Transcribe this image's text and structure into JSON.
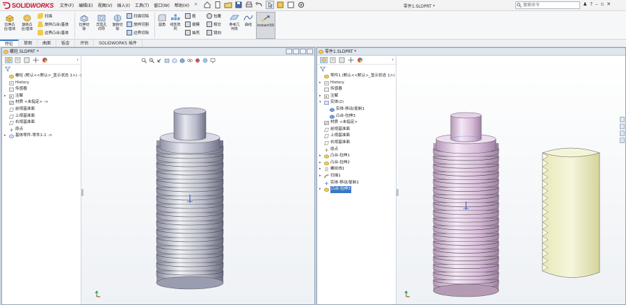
{
  "app": {
    "brand_prefix": "3S",
    "brand_solid": "SOLID",
    "brand_works": "WORKS",
    "doc_title": "零件1.SLDPRT *",
    "search_placeholder": "搜索命令"
  },
  "menu": [
    "文件(F)",
    "编辑(E)",
    "视图(V)",
    "插入(I)",
    "工具(T)",
    "窗口(W)",
    "帮助(H)"
  ],
  "ribbon": {
    "big": [
      {
        "label": "拉伸凸\n台/基体"
      },
      {
        "label": "旋转凸\n台/基体"
      },
      {
        "label": "拉伸切\n除"
      },
      {
        "label": "异型孔\n向导"
      },
      {
        "label": "旋转切\n除"
      },
      {
        "label": "参考几\n何体"
      },
      {
        "label": "曲线"
      },
      {
        "label": "Instant3D"
      }
    ],
    "small": [
      {
        "label": "扫描"
      },
      {
        "label": "放样凸台/基体"
      },
      {
        "label": "边界凸台/基体"
      },
      {
        "label": "扫描切除"
      },
      {
        "label": "放样切割"
      },
      {
        "label": "边界切除"
      },
      {
        "label": "圆角"
      },
      {
        "label": "线性阵\n列"
      },
      {
        "label": "筋"
      },
      {
        "label": "拔模"
      },
      {
        "label": "抽壳"
      },
      {
        "label": "包覆"
      },
      {
        "label": "相交"
      },
      {
        "label": "镜向"
      }
    ]
  },
  "tabs": [
    "特征",
    "草图",
    "曲面",
    "钣金",
    "评估",
    "SOLIDWORKS 插件"
  ],
  "left_window": {
    "title": "螺柱.SLDPRT *",
    "tree": [
      {
        "label": "螺柱 (默认<<默认>_显示状态 1>) ->",
        "icon": "part-icon",
        "arrow": ""
      },
      {
        "label": "History",
        "icon": "history-icon",
        "arrow": ""
      },
      {
        "label": "传感器",
        "icon": "sensor-icon",
        "arrow": ""
      },
      {
        "label": "注解",
        "icon": "annotation-icon",
        "arrow": "▸"
      },
      {
        "label": "材质 <未指定> ->",
        "icon": "material-icon",
        "arrow": ""
      },
      {
        "label": "前视基准面",
        "icon": "plane-icon",
        "arrow": ""
      },
      {
        "label": "上视基准面",
        "icon": "plane-icon",
        "arrow": ""
      },
      {
        "label": "右视基准面",
        "icon": "plane-icon",
        "arrow": ""
      },
      {
        "label": "原点",
        "icon": "origin-icon",
        "arrow": ""
      },
      {
        "label": "基体零件-零件1-1 ->",
        "icon": "base-part-icon",
        "arrow": "▸"
      }
    ]
  },
  "right_window": {
    "title": "零件1.SLDPRT *",
    "tree": [
      {
        "label": "零件1 (默认<<默认>_显示状态 1>)",
        "icon": "part-icon",
        "arrow": ""
      },
      {
        "label": "History",
        "icon": "history-icon",
        "arrow": "▸"
      },
      {
        "label": "传感器",
        "icon": "sensor-icon",
        "arrow": ""
      },
      {
        "label": "注解",
        "icon": "annotation-icon",
        "arrow": "▸"
      },
      {
        "label": "实体(2)",
        "icon": "solid-bodies-icon",
        "arrow": "▾"
      },
      {
        "label": "实体-移动/复制1",
        "icon": "body-icon",
        "arrow": "",
        "indent": 1
      },
      {
        "label": "凸台-拉伸3",
        "icon": "body-icon",
        "arrow": "",
        "indent": 1
      },
      {
        "label": "材质 <未指定>",
        "icon": "material-icon",
        "arrow": ""
      },
      {
        "label": "前视基准面",
        "icon": "plane-icon",
        "arrow": ""
      },
      {
        "label": "上视基准面",
        "icon": "plane-icon",
        "arrow": ""
      },
      {
        "label": "右视基准面",
        "icon": "plane-icon",
        "arrow": ""
      },
      {
        "label": "原点",
        "icon": "origin-icon",
        "arrow": ""
      },
      {
        "label": "凸台-拉伸1",
        "icon": "extrude-icon",
        "arrow": "▸"
      },
      {
        "label": "凸台-拉伸2",
        "icon": "extrude-icon",
        "arrow": "▸"
      },
      {
        "label": "螺纹线1",
        "icon": "helix-icon",
        "arrow": "▸"
      },
      {
        "label": "扫描1",
        "icon": "sweep-icon",
        "arrow": "▸"
      },
      {
        "label": "实体-移动/复制1",
        "icon": "move-icon",
        "arrow": ""
      },
      {
        "label": "凸台-拉伸3",
        "icon": "extrude-icon",
        "arrow": "▸",
        "highlight": true
      }
    ]
  },
  "colors": {
    "accent": "#3b78c4",
    "stud_body": "#c7c8d6",
    "pink_body": "#e6cfe6",
    "yellow_body": "#efefc9",
    "brand_red": "#c8102e"
  }
}
